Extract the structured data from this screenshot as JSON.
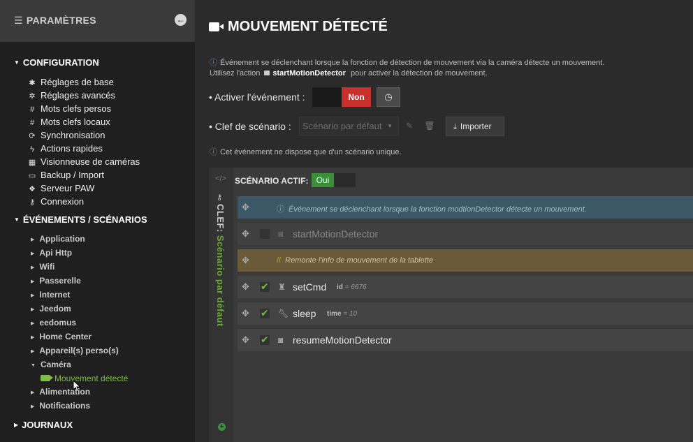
{
  "sidebar": {
    "title": "PARAMÈTRES",
    "title_icon": "sliders-icon",
    "collapse_icon": "arrow-left-circle-icon",
    "config_title": "CONFIGURATION",
    "config_items": [
      {
        "label": "Réglages de base",
        "icon": "gear"
      },
      {
        "label": "Réglages avancés",
        "icon": "gears"
      },
      {
        "label": "Mots clefs persos",
        "icon": "hash"
      },
      {
        "label": "Mots clefs locaux",
        "icon": "hash"
      },
      {
        "label": "Synchronisation",
        "icon": "sync"
      },
      {
        "label": "Actions rapides",
        "icon": "bolt"
      },
      {
        "label": "Visionneuse de caméras",
        "icon": "grid"
      },
      {
        "label": "Backup / Import",
        "icon": "drive"
      },
      {
        "label": "Serveur PAW",
        "icon": "paw"
      },
      {
        "label": "Connexion",
        "icon": "key"
      }
    ],
    "events_title": "ÉVÉNEMENTS / SCÉNARIOS",
    "event_items": [
      {
        "label": "Application"
      },
      {
        "label": "Api Http"
      },
      {
        "label": "Wifi"
      },
      {
        "label": "Passerelle"
      },
      {
        "label": "Internet"
      },
      {
        "label": "Jeedom"
      },
      {
        "label": "eedomus"
      },
      {
        "label": "Home Center"
      },
      {
        "label": "Appareil(s) perso(s)"
      },
      {
        "label": "Caméra"
      }
    ],
    "active_item": "Mouvement détecté",
    "after_items": [
      {
        "label": "Alimentation"
      },
      {
        "label": "Notifications"
      }
    ],
    "journaux_title": "JOURNAUX"
  },
  "main": {
    "title": "MOUVEMENT DÉTECTÉ",
    "info1": "Événement se déclenchant lorsque la fonction de détection de mouvement via la caméra détecte un mouvement.",
    "info2_pre": "Utilisez l'action",
    "info2_action": "startMotionDetector",
    "info2_post": "pour activer la détection de mouvement.",
    "activate_label": "• Activer l'événement :",
    "toggle_value": "Non",
    "scenario_key_label": "• Clef de scénario :",
    "scenario_select_value": "Scénario par défaut",
    "import_label": "Importer",
    "info3": "Cet événement ne dispose que d'un scénario unique."
  },
  "scenario": {
    "key_prefix": "CLEF:",
    "key_name": "Scénario par défaut",
    "active_label": "SCÉNARIO ACTIF:",
    "active_value": "Oui",
    "info_row": "Événement se déclenchant lorsque la fonction modtionDetector détecte un mouvement.",
    "action1": "startMotionDetector",
    "comment": "Remonte l'info de mouvement de la tablette",
    "action2": "setCmd",
    "action2_param_key": "id",
    "action2_param_val": "6676",
    "action3": "sleep",
    "action3_param_key": "time",
    "action3_param_val": "10",
    "action4": "resumeMotionDetector"
  },
  "colors": {
    "accent_green": "#7fbf3f",
    "danger_red": "#c9302c",
    "sidebar_bg": "#1f1f1f",
    "main_bg": "#2b2b2b"
  }
}
